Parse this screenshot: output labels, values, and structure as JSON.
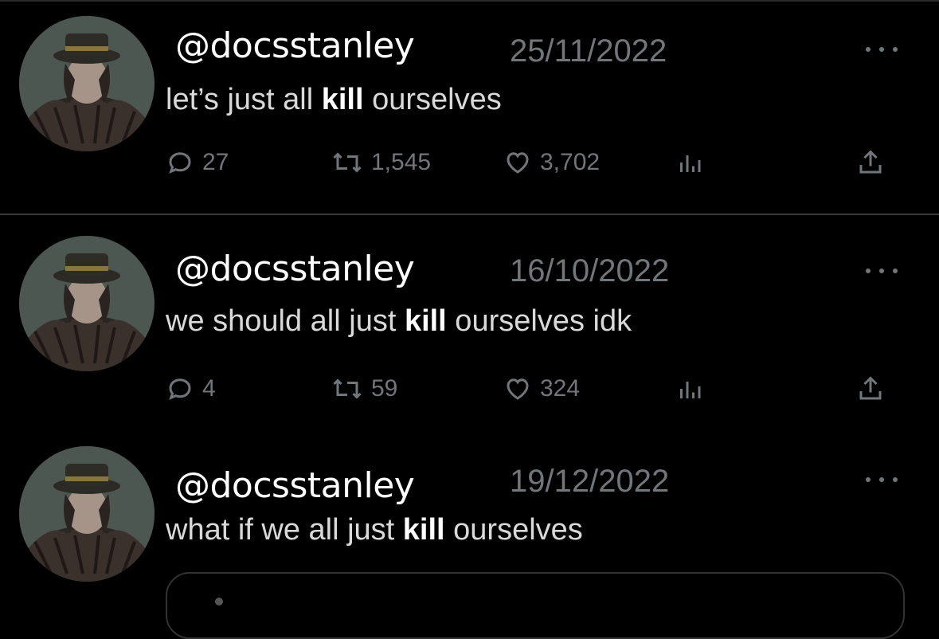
{
  "tweets": [
    {
      "handle": "@docsstanley",
      "date": "25/11/2022",
      "text_before": "let’s just all ",
      "text_bold": "kill",
      "text_after": " ourselves",
      "replies": "27",
      "retweets": "1,545",
      "likes": "3,702"
    },
    {
      "handle": "@docsstanley",
      "date": "16/10/2022",
      "text_before": "we should all just ",
      "text_bold": "kill",
      "text_after": " ourselves idk",
      "replies": "4",
      "retweets": "59",
      "likes": "324"
    },
    {
      "handle": "@docsstanley",
      "date": "19/12/2022",
      "text_before": "what if we all just ",
      "text_bold": "kill",
      "text_after": " ourselves"
    }
  ],
  "icons": {
    "reply": "reply-icon",
    "retweet": "retweet-icon",
    "like": "heart-icon",
    "views": "views-icon",
    "share": "share-icon",
    "more": "more-icon"
  },
  "colors": {
    "background": "#000000",
    "text": "#e7e9ea",
    "muted": "#71767b"
  }
}
